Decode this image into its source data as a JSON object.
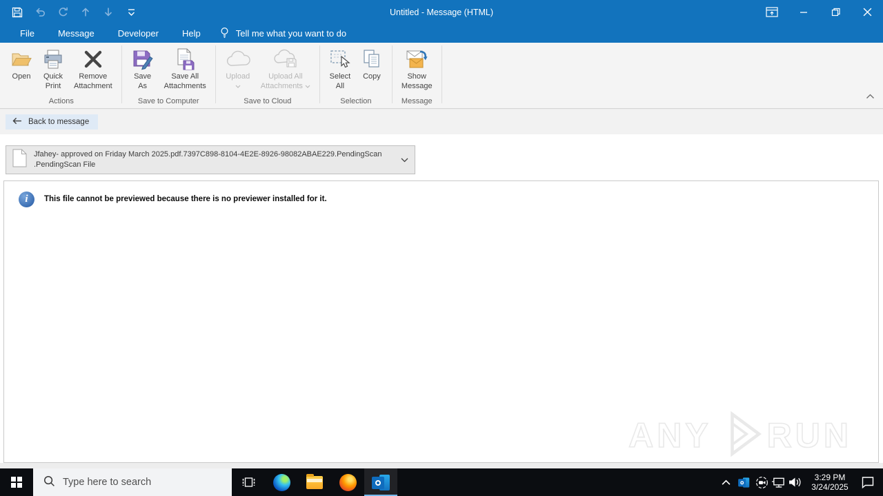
{
  "titlebar": {
    "title": "Untitled  -  Message (HTML)"
  },
  "tabs": {
    "file": "File",
    "message": "Message",
    "developer": "Developer",
    "help": "Help",
    "tellme": "Tell me what you want to do"
  },
  "ribbon": {
    "groups": [
      {
        "label": "Actions",
        "buttons": [
          {
            "l1": "Open",
            "l2": ""
          },
          {
            "l1": "Quick",
            "l2": "Print"
          },
          {
            "l1": "Remove",
            "l2": "Attachment"
          }
        ]
      },
      {
        "label": "Save to Computer",
        "buttons": [
          {
            "l1": "Save",
            "l2": "As"
          },
          {
            "l1": "Save All",
            "l2": "Attachments"
          }
        ]
      },
      {
        "label": "Save to Cloud",
        "buttons": [
          {
            "l1": "Upload",
            "l2": ""
          },
          {
            "l1": "Upload All",
            "l2": "Attachments"
          }
        ]
      },
      {
        "label": "Selection",
        "buttons": [
          {
            "l1": "Select",
            "l2": "All"
          },
          {
            "l1": "Copy",
            "l2": ""
          }
        ]
      },
      {
        "label": "Message",
        "buttons": [
          {
            "l1": "Show",
            "l2": "Message"
          }
        ]
      }
    ]
  },
  "back_bar": {
    "label": "Back to message"
  },
  "attachment": {
    "name_line1": "Jfahey- approved on Friday March 2025.pdf.7397C898-8104-4E2E-8926-98082ABAE229.PendingScan",
    "name_line2": ".PendingScan File"
  },
  "preview": {
    "info_glyph": "i",
    "message": "This file cannot be previewed because there is no previewer installed for it."
  },
  "watermark": {
    "left": "ANY",
    "right": "RUN"
  },
  "taskbar": {
    "search_placeholder": "Type here to search",
    "clock": {
      "time": "3:29 PM",
      "date": "3/24/2025"
    }
  },
  "colors": {
    "titlebar_blue": "#1273bd",
    "taskbar_dark": "#0b0d11",
    "save_purple": "#8d6cc3",
    "folder_yellow": "#efc06a",
    "envelope_orange": "#f3b44d",
    "info_blue": "#3c6fb4",
    "active_underline": "#76b9ed"
  }
}
